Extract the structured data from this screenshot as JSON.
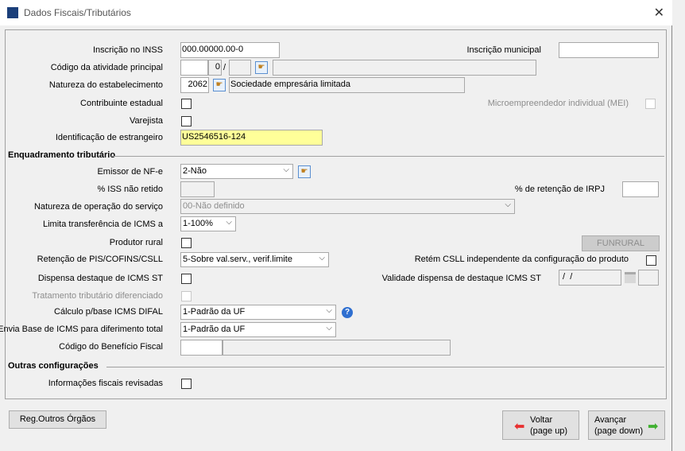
{
  "window": {
    "title": "Dados Fiscais/Tributários",
    "close_icon": "close-icon"
  },
  "fields": {
    "inss_label": "Inscrição no INSS",
    "inss_value": "000.00000.00-0",
    "inscricao_municipal_label": "Inscrição municipal",
    "inscricao_municipal_value": "",
    "codigo_atividade_label": "Código da atividade principal",
    "codigo_atividade_digit": "0",
    "codigo_atividade_sep": "/",
    "natureza_label": "Natureza do estabelecimento",
    "natureza_code": "2062",
    "natureza_desc": "Sociedade empresária limitada",
    "contribuinte_label": "Contribuinte estadual",
    "contribuinte_checked": false,
    "mei_label": "Microempreendedor individual (MEI)",
    "mei_checked": false,
    "varejista_label": "Varejista",
    "varejista_checked": false,
    "estrangeiro_label": "Identificação de estrangeiro",
    "estrangeiro_value": "US2546516-124"
  },
  "enquadramento": {
    "section_title": "Enquadramento tributário",
    "emissor_label": "Emissor de NF-e",
    "emissor_value": "2-Não",
    "iss_label": "% ISS não retido",
    "irpj_label": "% de retenção de IRPJ",
    "natureza_servico_label": "Natureza de operação do serviço",
    "natureza_servico_value": "00-Não definido",
    "limita_label": "Limita transferência de ICMS a",
    "limita_value": "1-100%",
    "produtor_label": "Produtor rural",
    "produtor_checked": false,
    "funrural_label": "FUNRURAL",
    "retencao_label": "Retenção de PIS/COFINS/CSLL",
    "retencao_value": "5-Sobre val.serv., verif.limite",
    "retem_csll_label": "Retém CSLL independente da configuração do produto",
    "retem_csll_checked": false,
    "dispensa_label": "Dispensa destaque de ICMS ST",
    "dispensa_checked": false,
    "validade_label": "Validade dispensa de destaque ICMS ST",
    "validade_value": " /  /",
    "tratamento_label": "Tratamento tributário diferenciado",
    "tratamento_checked": false,
    "calculo_label": "Cálculo p/base ICMS DIFAL",
    "calculo_value": "1-Padrão da UF",
    "help_glyph": "?",
    "envia_label": "Envia Base de ICMS para diferimento total",
    "envia_value": "1-Padrão da UF",
    "beneficio_label": "Código do Benefício Fiscal"
  },
  "outras": {
    "section_title": "Outras configurações",
    "revisadas_label": "Informações fiscais revisadas",
    "revisadas_checked": false
  },
  "footer": {
    "reg_label": "Reg.Outros Órgãos",
    "voltar_label": "Voltar",
    "voltar_sub": "(page up)",
    "avancar_label": "Avançar",
    "avancar_sub": "(page down)",
    "back_color": "#e83030",
    "next_color": "#40b030"
  }
}
